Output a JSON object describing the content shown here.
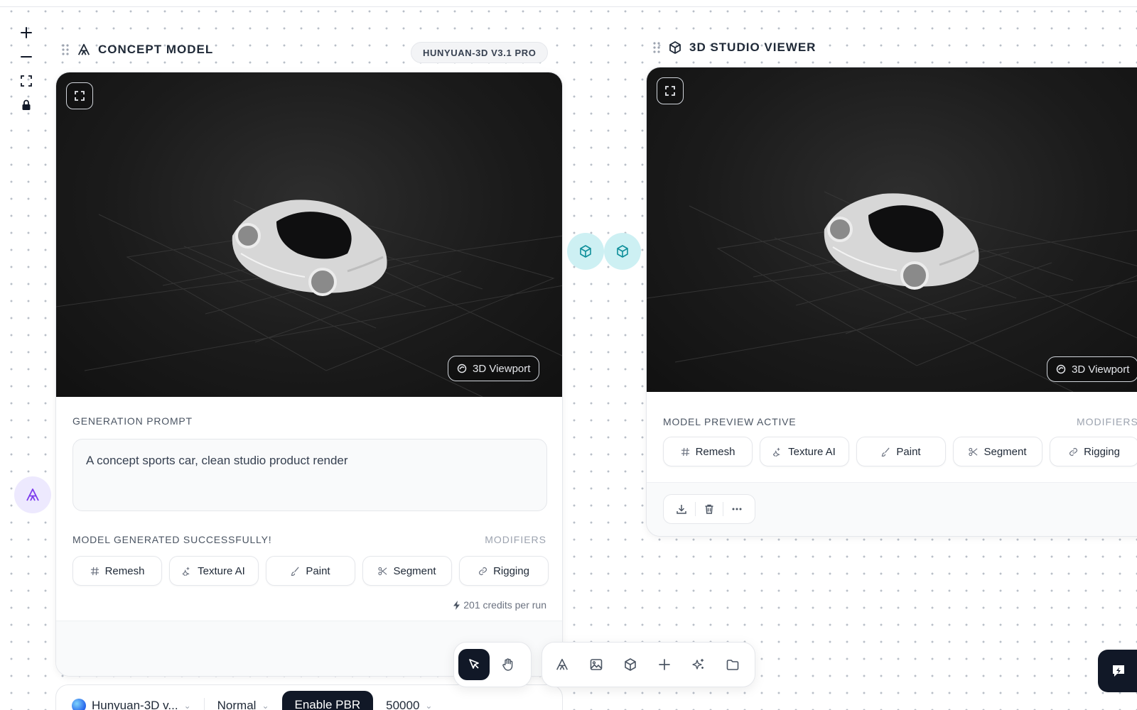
{
  "zoom_controls": {
    "zoom_in": "+",
    "zoom_out": "−"
  },
  "left_node": {
    "title": "CONCEPT MODEL",
    "model_badge": "HUNYUAN-3D V3.1 PRO",
    "viewport_badge": "3D Viewport",
    "prompt_label": "GENERATION PROMPT",
    "prompt_text": "A concept sports car, clean studio product render",
    "status_text": "MODEL GENERATED SUCCESSFULLY!",
    "modifiers_label": "MODIFIERS",
    "modifiers": [
      {
        "label": "Remesh",
        "icon": "hash-icon"
      },
      {
        "label": "Texture AI",
        "icon": "sparkle-icon"
      },
      {
        "label": "Paint",
        "icon": "brush-icon"
      },
      {
        "label": "Segment",
        "icon": "scissors-icon"
      },
      {
        "label": "Rigging",
        "icon": "link-icon"
      }
    ],
    "credits_text": "201 credits per run"
  },
  "right_node": {
    "title": "3D STUDIO VIEWER",
    "viewport_badge": "3D Viewport",
    "status_text": "MODEL PREVIEW ACTIVE",
    "modifiers_label": "MODIFIERS",
    "modifiers": [
      {
        "label": "Remesh",
        "icon": "hash-icon"
      },
      {
        "label": "Texture AI",
        "icon": "sparkle-icon"
      },
      {
        "label": "Paint",
        "icon": "brush-icon"
      },
      {
        "label": "Segment",
        "icon": "scissors-icon"
      },
      {
        "label": "Rigging",
        "icon": "link-icon"
      }
    ],
    "actions": [
      "download-icon",
      "trash-icon",
      "more-icon"
    ]
  },
  "toolbar": {
    "mode_tools": [
      "cursor-icon",
      "hand-icon"
    ],
    "create_tools": [
      "text-node-icon",
      "image-icon",
      "cube-icon",
      "plus-icon",
      "sparkles-icon",
      "folder-icon"
    ]
  },
  "settings_bar": {
    "model_select": "Hunyuan-3D v...",
    "quality_select": "Normal",
    "pbr_button": "Enable PBR",
    "face_count": "50000"
  },
  "colors": {
    "accent_dark": "#111827",
    "connector_bg": "#cdf0f3",
    "connector_icon": "#0e8f9a",
    "avatar_bg": "#ede9fe",
    "avatar_icon": "#7c3aed"
  }
}
